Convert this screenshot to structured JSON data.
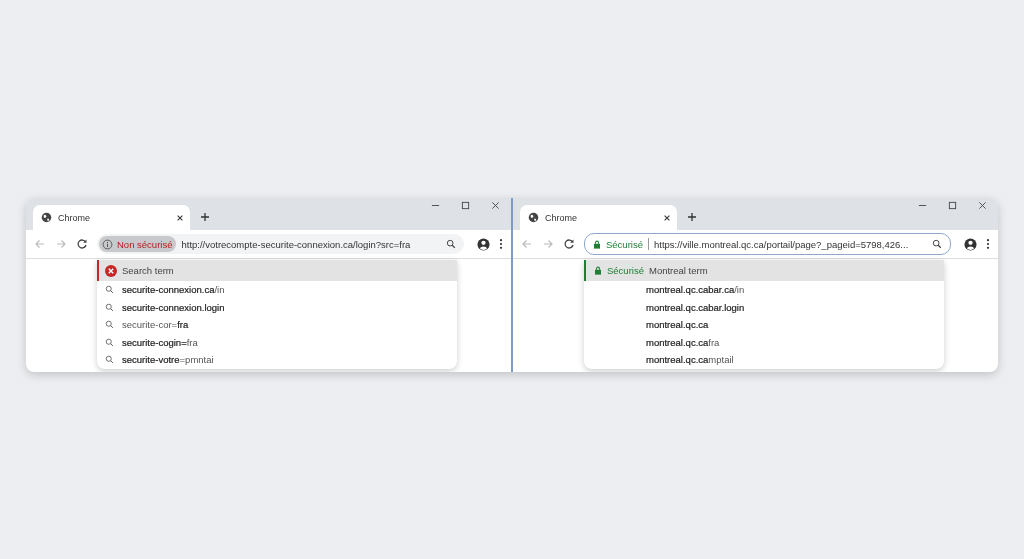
{
  "windows": [
    {
      "tab": {
        "title": "Chrome",
        "selected": true
      },
      "security": {
        "kind": "insecure",
        "label": "Non sécurisé"
      },
      "url": "http://votrecompte-securite-connexion.ca/login?src=fra",
      "suggest_header": {
        "kind": "error",
        "text": "Search term"
      },
      "suggestions": [
        {
          "kind": "search",
          "text": "**securite-connexion.ca**/in"
        },
        {
          "kind": "search",
          "text": "**securite-connexion.login**"
        },
        {
          "kind": "search",
          "text": "securite-cor=**fra**"
        },
        {
          "kind": "search",
          "text": "**securite-cogin=**fra"
        },
        {
          "kind": "search",
          "text": "**securite-votre**=pmntai"
        }
      ]
    },
    {
      "tab": {
        "title": "Chrome",
        "selected": true
      },
      "security": {
        "kind": "secure",
        "label": "Sécurisé"
      },
      "url": "https://ville.montreal.qc.ca/portail/page?_pageid=5798,426...",
      "suggest_header": {
        "kind": "secure",
        "label": "Sécurisé",
        "text": "Montreal term"
      },
      "suggestions": [
        {
          "kind": "plain",
          "text": "**montreal.qc.cabar.ca**/in"
        },
        {
          "kind": "plain",
          "text": "**montreal.qc.cabar.login**"
        },
        {
          "kind": "plain",
          "text": "**montreal.qc.ca**"
        },
        {
          "kind": "plain",
          "text": "**montreal.qc.ca**fra"
        },
        {
          "kind": "plain",
          "text": "**montreal.qc.ca**mptail"
        }
      ]
    }
  ]
}
